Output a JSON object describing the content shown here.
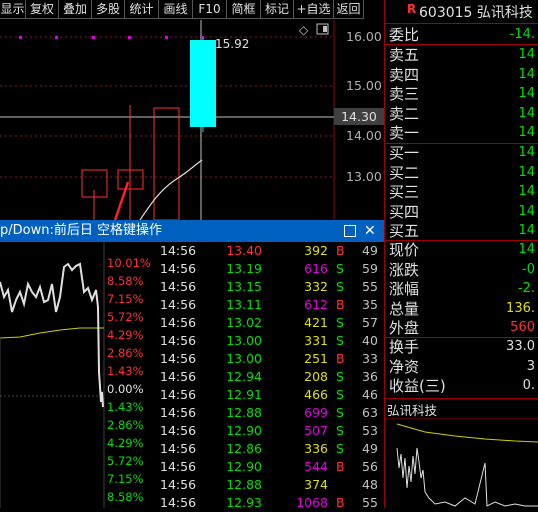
{
  "toolbar": {
    "buttons": [
      "显示",
      "复权",
      "叠加",
      "多股",
      "统计",
      "画线",
      "F10",
      "简框",
      "标记",
      "+自选",
      "返回"
    ]
  },
  "kline": {
    "price_labels": [
      "16.00",
      "15.00",
      "14.00",
      "13.00"
    ],
    "current_price": "14.30",
    "high_label": "15.92"
  },
  "popup": {
    "title": "p/Down:前后日 空格键操作",
    "pct_labels_up": [
      "10.01%",
      "8.58%",
      "7.15%",
      "5.72%",
      "4.29%",
      "2.86%",
      "1.43%"
    ],
    "zero_label": "0.00%",
    "pct_labels_down": [
      "1.43%",
      "2.86%",
      "4.29%",
      "5.72%",
      "7.15%",
      "8.58%"
    ],
    "colors": {
      "up": "#ff3030",
      "down": "#00e000",
      "bar": "#c0c0c0"
    }
  },
  "ticks": [
    {
      "time": "14:56",
      "price": "13.40",
      "vol": "392",
      "bs": "B",
      "n": "49"
    },
    {
      "time": "14:56",
      "price": "13.19",
      "vol": "616",
      "bs": "S",
      "n": "59"
    },
    {
      "time": "14:56",
      "price": "13.15",
      "vol": "332",
      "bs": "S",
      "n": "55"
    },
    {
      "time": "14:56",
      "price": "13.11",
      "vol": "612",
      "bs": "B",
      "n": "35"
    },
    {
      "time": "14:56",
      "price": "13.02",
      "vol": "421",
      "bs": "S",
      "n": "57"
    },
    {
      "time": "14:56",
      "price": "13.00",
      "vol": "331",
      "bs": "S",
      "n": "40"
    },
    {
      "time": "14:56",
      "price": "13.00",
      "vol": "251",
      "bs": "B",
      "n": "33"
    },
    {
      "time": "14:56",
      "price": "12.94",
      "vol": "208",
      "bs": "S",
      "n": "36"
    },
    {
      "time": "14:56",
      "price": "12.91",
      "vol": "466",
      "bs": "S",
      "n": "46"
    },
    {
      "time": "14:56",
      "price": "12.88",
      "vol": "699",
      "bs": "S",
      "n": "63"
    },
    {
      "time": "14:56",
      "price": "12.90",
      "vol": "507",
      "bs": "S",
      "n": "53"
    },
    {
      "time": "14:56",
      "price": "12.86",
      "vol": "336",
      "bs": "S",
      "n": "49"
    },
    {
      "time": "14:56",
      "price": "12.90",
      "vol": "544",
      "bs": "B",
      "n": "56"
    },
    {
      "time": "14:56",
      "price": "12.88",
      "vol": "374",
      "bs": "",
      "n": "48"
    },
    {
      "time": "14:56",
      "price": "12.93",
      "vol": "1068",
      "bs": "B",
      "n": "55"
    }
  ],
  "right_panel": {
    "header_badge": "R",
    "code_name": "603015 弘讯科技",
    "weibi": {
      "label": "委比",
      "value": "-14."
    },
    "sells": [
      {
        "label": "卖五",
        "value": "14"
      },
      {
        "label": "卖四",
        "value": "14"
      },
      {
        "label": "卖三",
        "value": "14"
      },
      {
        "label": "卖二",
        "value": "14"
      },
      {
        "label": "卖一",
        "value": "14"
      }
    ],
    "buys": [
      {
        "label": "买一",
        "value": "14"
      },
      {
        "label": "买二",
        "value": "14"
      },
      {
        "label": "买三",
        "value": "14"
      },
      {
        "label": "买四",
        "value": "14"
      },
      {
        "label": "买五",
        "value": "14"
      }
    ],
    "stats": [
      {
        "label": "现价",
        "value": "14"
      },
      {
        "label": "涨跌",
        "value": "-0"
      },
      {
        "label": "涨幅",
        "value": "-2."
      },
      {
        "label": "总量",
        "value": "136."
      },
      {
        "label": "外盘",
        "value": "560"
      }
    ],
    "stats2": [
      {
        "label": "换手",
        "value": "33.0"
      },
      {
        "label": "净资",
        "value": "3"
      },
      {
        "label": "收益(三)",
        "value": "0."
      }
    ],
    "mini_title": "弘讯科技"
  }
}
